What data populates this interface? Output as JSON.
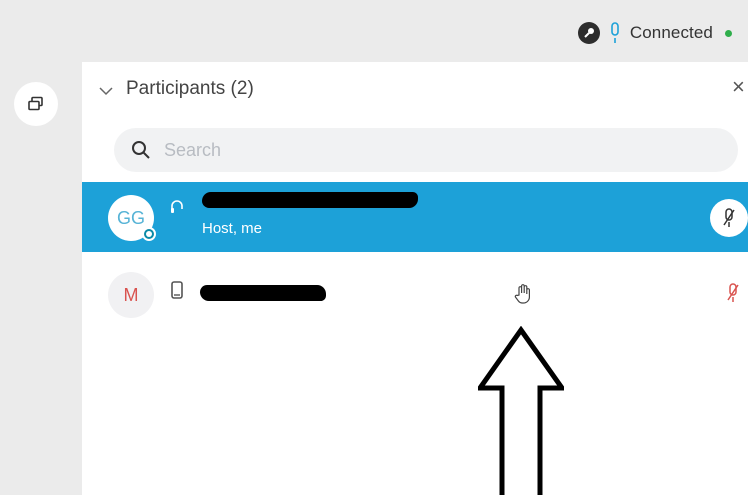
{
  "status": {
    "connection_label": "Connected",
    "connection_color": "#2fae4b",
    "icons": [
      "lock-icon",
      "microphone-icon"
    ]
  },
  "rail": {
    "popout_icon": "popout-window-icon"
  },
  "panel": {
    "title": "Participants (2)",
    "close_glyph": "×",
    "search_placeholder": "Search"
  },
  "participants": [
    {
      "initials": "GG",
      "role": "Host, me",
      "selected": true,
      "device_icon": "headset-icon",
      "presence": "online",
      "audio": "muted"
    },
    {
      "initials": "M",
      "role": "",
      "selected": false,
      "device_icon": "phone-icon",
      "raised_hand": true,
      "audio": "muted"
    }
  ],
  "colors": {
    "selected_row": "#1da1d8",
    "muted_red": "#d9534f",
    "chrome": "#ebebeb"
  }
}
